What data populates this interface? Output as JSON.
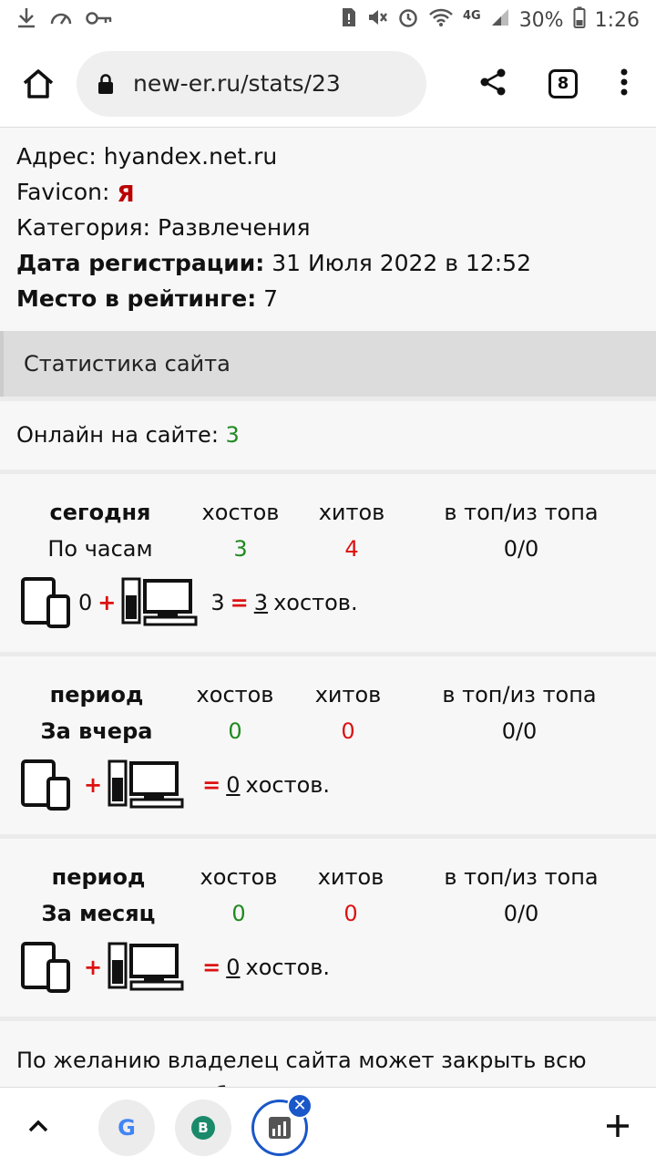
{
  "status_bar": {
    "battery": "30%",
    "time": "1:26",
    "network": "4G"
  },
  "browser": {
    "url": "new-er.ru/stats/23",
    "tab_count": "8"
  },
  "site_info": {
    "address_label": "Адрес:",
    "address_value": "hyandex.net.ru",
    "favicon_label": "Favicon:",
    "favicon_glyph": "Я",
    "category_label": "Категория:",
    "category_value": "Развлечения",
    "reg_date_label": "Дата регистрации:",
    "reg_date_value": "31 Июля 2022 в 12:52",
    "rank_label": "Место в рейтинге:",
    "rank_value": "7"
  },
  "stats": {
    "section_title": "Статистика сайта",
    "online_label": "Онлайн на сайте:",
    "online_value": "3",
    "cards": [
      {
        "period_header": "сегодня",
        "hosts_header": "хостов",
        "hits_header": "хитов",
        "top_header": "в топ/из топа",
        "period_label": "По часам",
        "hosts": "3",
        "hits": "4",
        "top": "0/0",
        "mobile": "0",
        "desktop": "3",
        "total": "3",
        "total_suffix": "хостов."
      },
      {
        "period_header": "период",
        "hosts_header": "хостов",
        "hits_header": "хитов",
        "top_header": "в топ/из топа",
        "period_label": "За вчера",
        "hosts": "0",
        "hits": "0",
        "top": "0/0",
        "mobile": "",
        "desktop": "",
        "total": "0",
        "total_suffix": "хостов."
      },
      {
        "period_header": "период",
        "hosts_header": "хостов",
        "hits_header": "хитов",
        "top_header": "в топ/из топа",
        "period_label": "За месяц",
        "hosts": "0",
        "hits": "0",
        "top": "0/0",
        "mobile": "",
        "desktop": "",
        "total": "0",
        "total_suffix": "хостов."
      }
    ],
    "note": "По желанию владелец сайта может закрыть всю статистику от публичного просмотра"
  },
  "bottom_tabs": {
    "tab1_letter": "G",
    "tab2_letter": "B"
  }
}
